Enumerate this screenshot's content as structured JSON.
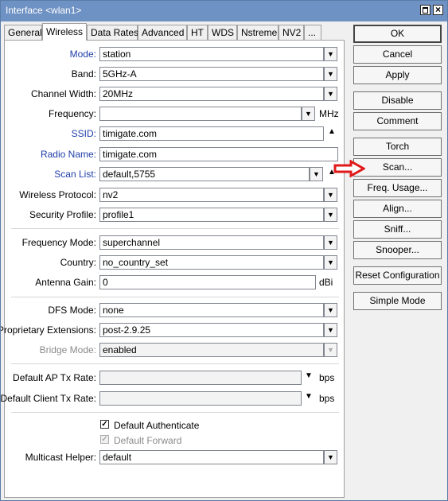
{
  "window": {
    "title": "Interface <wlan1>"
  },
  "tabs": [
    "General",
    "Wireless",
    "Data Rates",
    "Advanced",
    "HT",
    "WDS",
    "Nstreme",
    "NV2",
    "..."
  ],
  "form": {
    "mode": {
      "label": "Mode:",
      "value": "station"
    },
    "band": {
      "label": "Band:",
      "value": "5GHz-A"
    },
    "channel_width": {
      "label": "Channel Width:",
      "value": "20MHz"
    },
    "frequency": {
      "label": "Frequency:",
      "value": "",
      "unit": "MHz"
    },
    "ssid": {
      "label": "SSID:",
      "value": "timigate.com"
    },
    "radio_name": {
      "label": "Radio Name:",
      "value": "timigate.com"
    },
    "scan_list": {
      "label": "Scan List:",
      "value": "default,5755"
    },
    "wireless_protocol": {
      "label": "Wireless Protocol:",
      "value": "nv2"
    },
    "security_profile": {
      "label": "Security Profile:",
      "value": "profile1"
    },
    "frequency_mode": {
      "label": "Frequency Mode:",
      "value": "superchannel"
    },
    "country": {
      "label": "Country:",
      "value": "no_country_set"
    },
    "antenna_gain": {
      "label": "Antenna Gain:",
      "value": "0",
      "unit": "dBi"
    },
    "dfs_mode": {
      "label": "DFS Mode:",
      "value": "none"
    },
    "proprietary_extensions": {
      "label": "Proprietary Extensions:",
      "value": "post-2.9.25"
    },
    "bridge_mode": {
      "label": "Bridge Mode:",
      "value": "enabled"
    },
    "default_ap_tx_rate": {
      "label": "Default AP Tx Rate:",
      "value": "",
      "unit": "bps"
    },
    "default_client_tx_rate": {
      "label": "Default Client Tx Rate:",
      "value": "",
      "unit": "bps"
    },
    "default_authenticate": {
      "label": "Default Authenticate",
      "checked": true
    },
    "default_forward": {
      "label": "Default Forward",
      "checked": true
    },
    "multicast_helper": {
      "label": "Multicast Helper:",
      "value": "default"
    }
  },
  "buttons": {
    "ok": "OK",
    "cancel": "Cancel",
    "apply": "Apply",
    "disable": "Disable",
    "comment": "Comment",
    "torch": "Torch",
    "scan": "Scan...",
    "freq_usage": "Freq. Usage...",
    "align": "Align...",
    "sniff": "Sniff...",
    "snooper": "Snooper...",
    "reset_configuration": "Reset Configuration",
    "simple_mode": "Simple Mode"
  },
  "colors": {
    "titlebar": "#6f92c4",
    "link_label": "#1f3da8",
    "annotation_arrow": "#e01a1a"
  },
  "icons": {
    "dropdown": "down-arrow-icon",
    "collapse": "up-triangle-icon",
    "annotation": "red-arrow-icon"
  }
}
